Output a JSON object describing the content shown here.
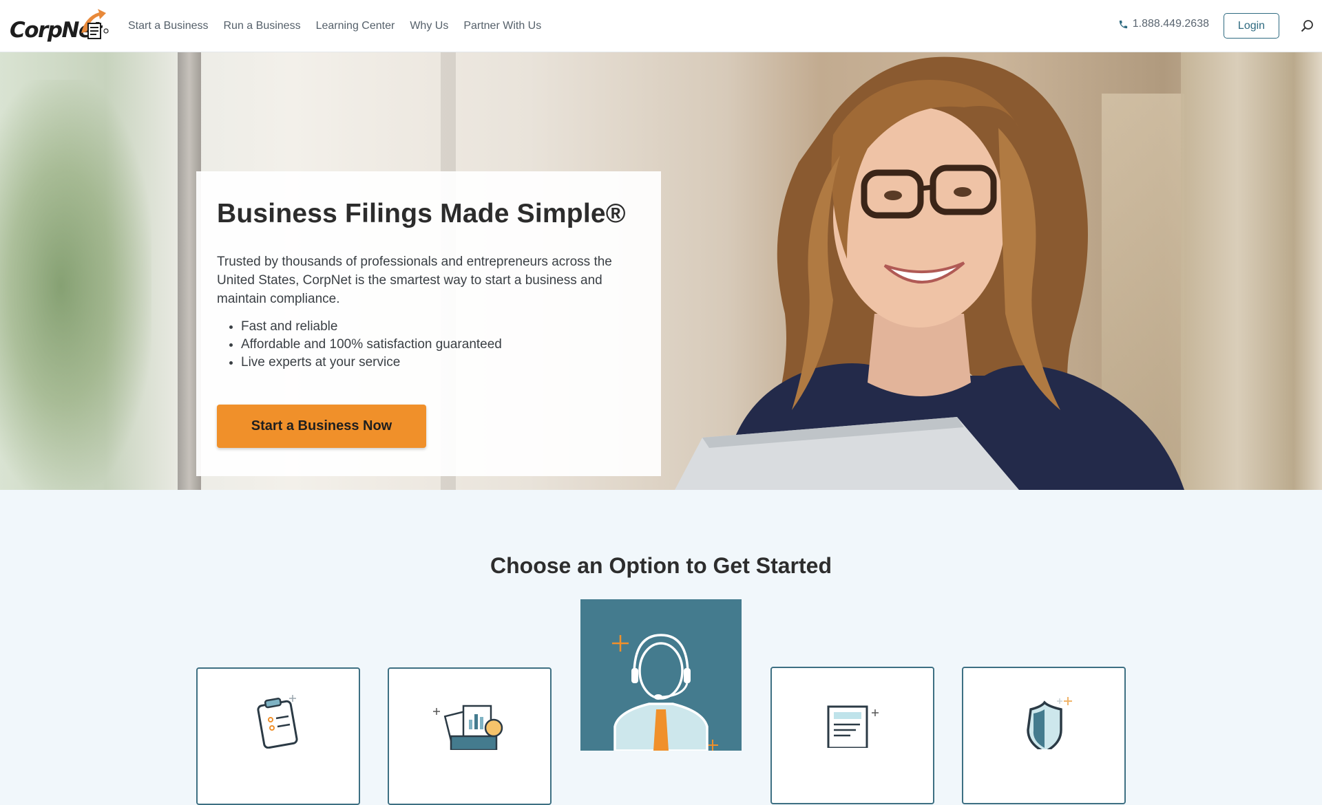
{
  "header": {
    "logo_text": "CorpNet",
    "nav": [
      "Start a Business",
      "Run a Business",
      "Learning Center",
      "Why Us",
      "Partner With Us"
    ],
    "phone": "1.888.449.2638",
    "login_label": "Login"
  },
  "hero": {
    "title": "Business Filings Made Simple®",
    "description": "Trusted by thousands of professionals and entrepreneurs across the United States, CorpNet is the smartest way to start a business and maintain compliance.",
    "bullets": [
      "Fast and reliable",
      "Affordable and 100% satisfaction guaranteed",
      "Live experts at your service"
    ],
    "cta_label": "Start a Business Now"
  },
  "options": {
    "title": "Choose an Option to Get Started"
  },
  "colors": {
    "accent": "#f0902a",
    "brand_teal": "#447b8e",
    "card_border": "#3d6f82",
    "section_bg": "#f1f7fb"
  },
  "icons": [
    "phone-icon",
    "search-icon",
    "clipboard-icon",
    "documents-chart-icon",
    "support-agent-icon",
    "document-icon",
    "shield-icon"
  ]
}
